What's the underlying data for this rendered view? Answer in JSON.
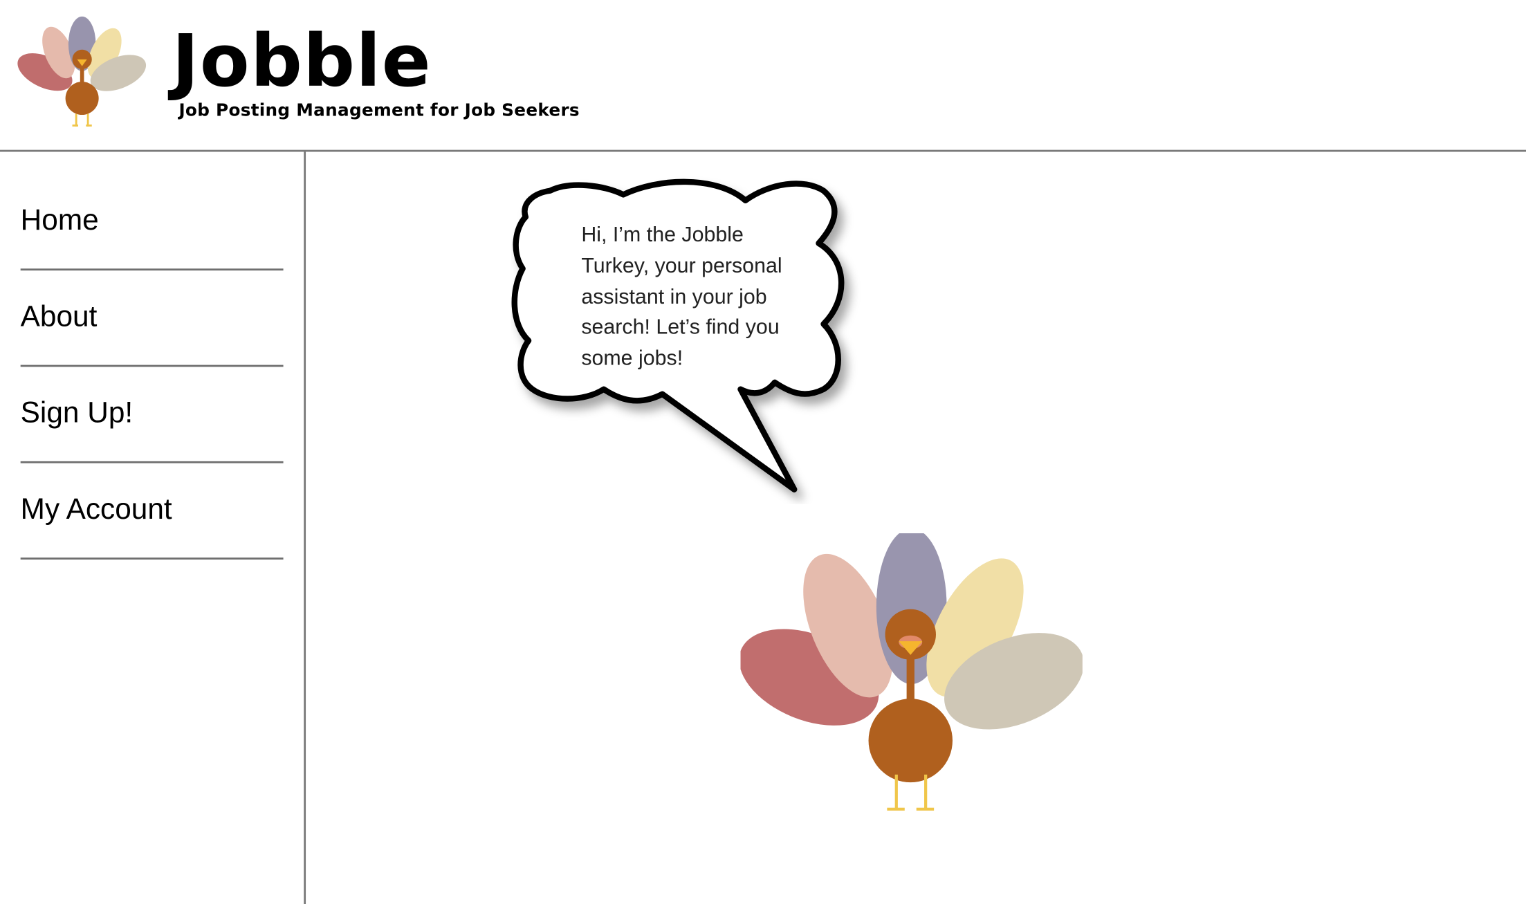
{
  "header": {
    "title": "Jobble",
    "subtitle": "Job Posting Management for Job Seekers",
    "logo_icon": "turkey-logo-icon"
  },
  "sidebar": {
    "items": [
      {
        "label": "Home"
      },
      {
        "label": "About"
      },
      {
        "label": "Sign Up!"
      },
      {
        "label": "My Account"
      }
    ]
  },
  "main": {
    "bubble_text": "Hi, I’m the Jobble Turkey, your personal assistant in your job search! Let’s find you some jobs!",
    "mascot_icon": "turkey-mascot-icon"
  },
  "colors": {
    "feather_red": "#b85959",
    "feather_pink": "#e2b1a1",
    "feather_purple": "#8a86a2",
    "feather_yellow": "#efdb99",
    "feather_gray": "#c8bfac",
    "body_brown": "#b0601e",
    "beak_yellow": "#f5b52e",
    "legs_yellow": "#f0c64a",
    "divider": "#7a7a7a"
  }
}
